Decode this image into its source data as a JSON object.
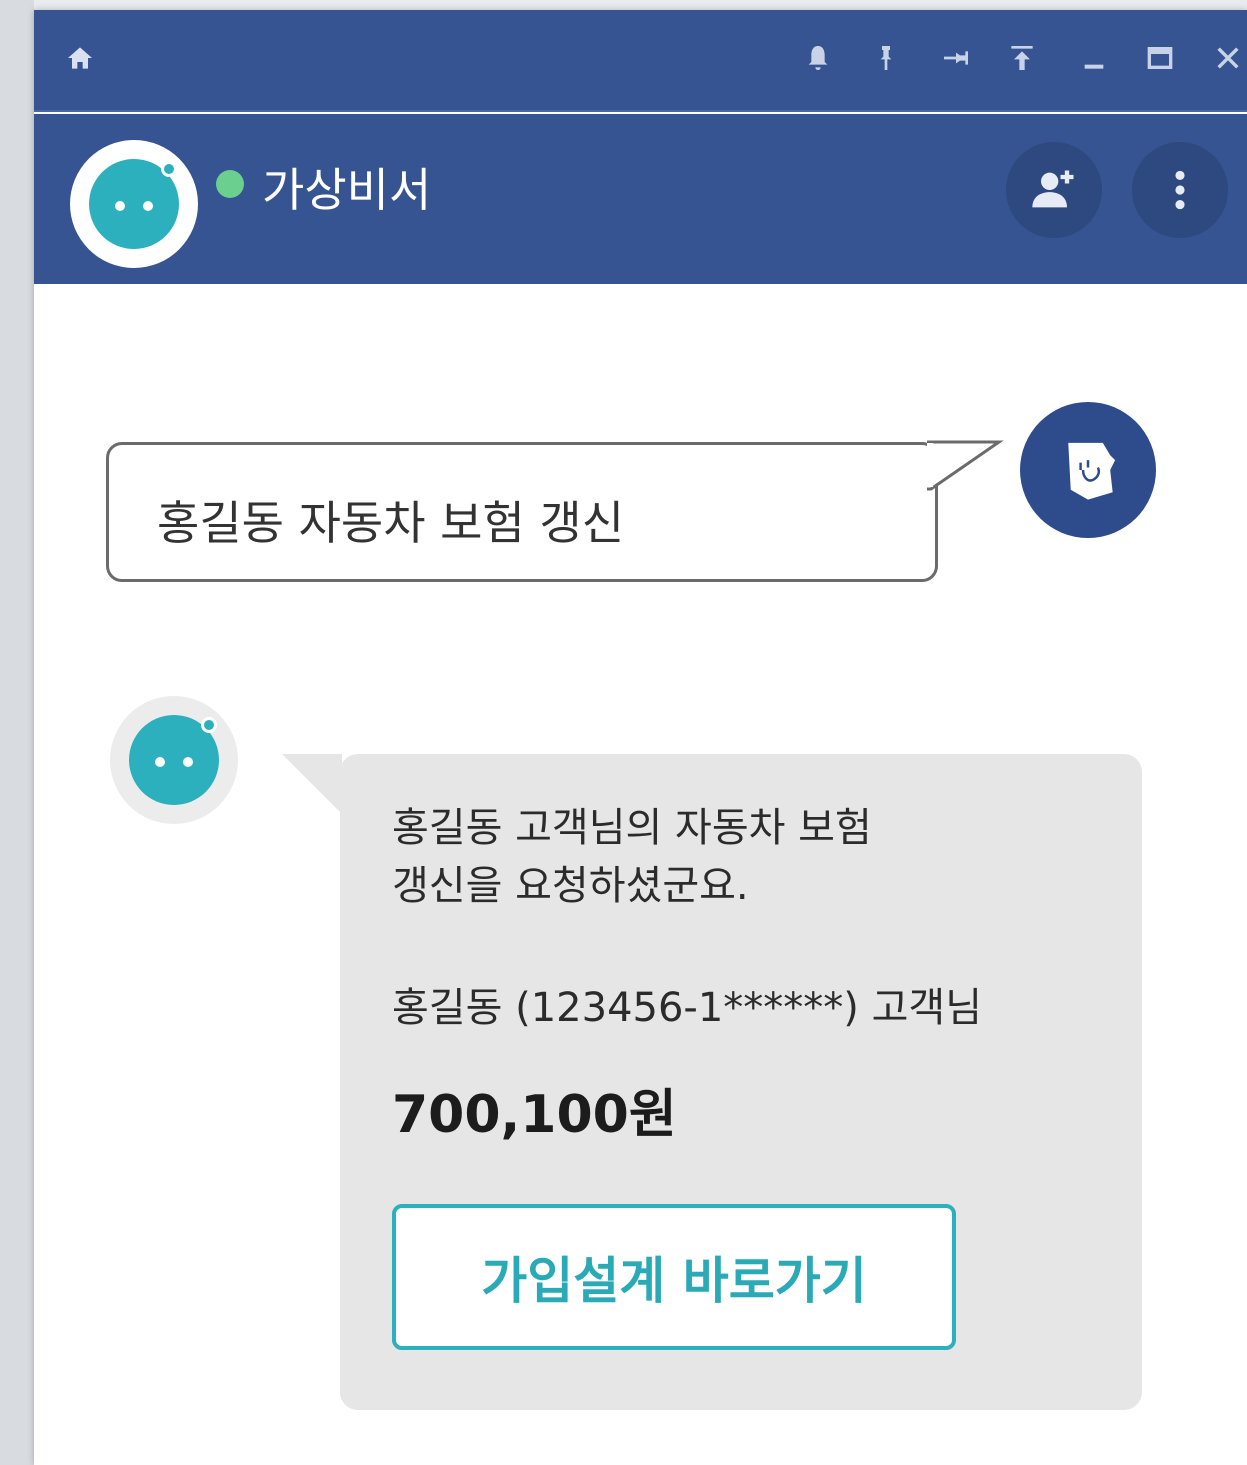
{
  "window": {
    "controls": [
      "home-icon",
      "bell-icon",
      "pin-icon",
      "pin-side-icon",
      "move-to-top-icon",
      "minimize-icon",
      "maximize-icon",
      "close-icon"
    ]
  },
  "header": {
    "title": "가상비서",
    "status_color": "#6bcf8f",
    "actions": [
      "add-person-icon",
      "more-vertical-icon"
    ]
  },
  "chat": {
    "user_message": "홍길동 자동차 보험 갱신",
    "bot_message": {
      "line1": "홍길동 고객님의 자동차 보험",
      "line2": "갱신을 요청하셨군요.",
      "customer": "홍길동 (123456-1******) 고객님",
      "amount": "700,100원",
      "button_label": "가입설계 바로가기"
    }
  },
  "colors": {
    "header_bg": "#365491",
    "bot_accent": "#2db0bd",
    "bot_bubble": "#e6e6e6"
  }
}
